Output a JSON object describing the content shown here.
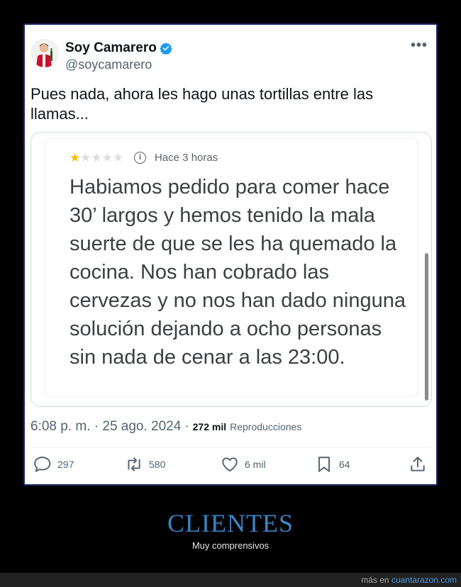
{
  "tweet": {
    "display_name": "Soy Camarero",
    "handle": "@soycamarero",
    "text": "Pues nada, ahora les hago unas tortillas entre las llamas...",
    "more_label": "•••",
    "verified_color": "#1d9bf0",
    "review": {
      "rating": 1,
      "max_rating": 5,
      "info_symbol": "i",
      "time": "Hace 3 horas",
      "body": "Habiamos pedido para comer hace 30’ largos y hemos tenido la mala suerte de que se les ha quemado la cocina. Nos han cobrado las cervezas y no nos han dado ninguna solución dejando a ocho personas sin nada de cenar a las 23:00."
    },
    "timestamp": "6:08 p. m. · 25 ago. 2024",
    "separator": "·",
    "views_count": "272 mil",
    "views_label": "Reproducciones",
    "actions": {
      "replies": "297",
      "reposts": "580",
      "likes": "6 mil",
      "bookmarks": "64"
    }
  },
  "caption": {
    "title": "CLIENTES",
    "subtitle": "Muy comprensivos"
  },
  "footer": {
    "prefix": "más en ",
    "site": "cuantarazon.com"
  },
  "colors": {
    "caption_title": "#3a84c5",
    "star_on": "#fbbc04",
    "frame_border": "#1d2a6b"
  }
}
